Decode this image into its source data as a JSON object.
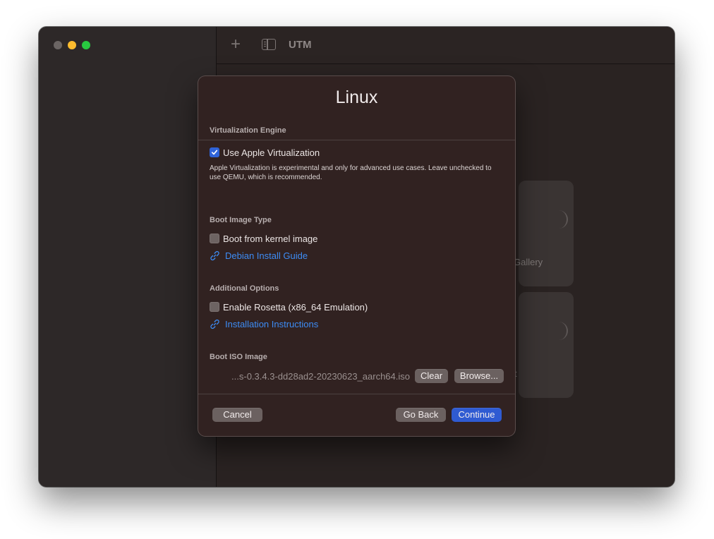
{
  "window": {
    "title": "UTM",
    "toolbar": {
      "add_icon": "plus-icon",
      "sidebar_toggle_icon": "sidebar-toggle-icon"
    }
  },
  "background": {
    "card_gallery_label": "Gallery",
    "card_second_label": "t"
  },
  "dialog": {
    "title": "Linux",
    "virtualization": {
      "header": "Virtualization Engine",
      "use_apple_label": "Use Apple Virtualization",
      "use_apple_checked": true,
      "help": "Apple Virtualization is experimental and only for advanced use cases. Leave unchecked to use QEMU, which is recommended."
    },
    "boot_image": {
      "header": "Boot Image Type",
      "kernel_label": "Boot from kernel image",
      "kernel_checked": false,
      "guide_link": "Debian Install Guide"
    },
    "additional": {
      "header": "Additional Options",
      "rosetta_label": "Enable Rosetta (x86_64 Emulation)",
      "rosetta_checked": false,
      "instructions_link": "Installation Instructions"
    },
    "iso": {
      "header": "Boot ISO Image",
      "path": "...s-0.3.4.3-dd28ad2-20230623_aarch64.iso",
      "clear_label": "Clear",
      "browse_label": "Browse..."
    },
    "footer": {
      "cancel_label": "Cancel",
      "back_label": "Go Back",
      "continue_label": "Continue"
    }
  },
  "colors": {
    "accent": "#2f5bd2",
    "link": "#3d8cf5",
    "traffic_close": "#6b6564",
    "traffic_minimize": "#febc2e",
    "traffic_maximize": "#28c840"
  }
}
